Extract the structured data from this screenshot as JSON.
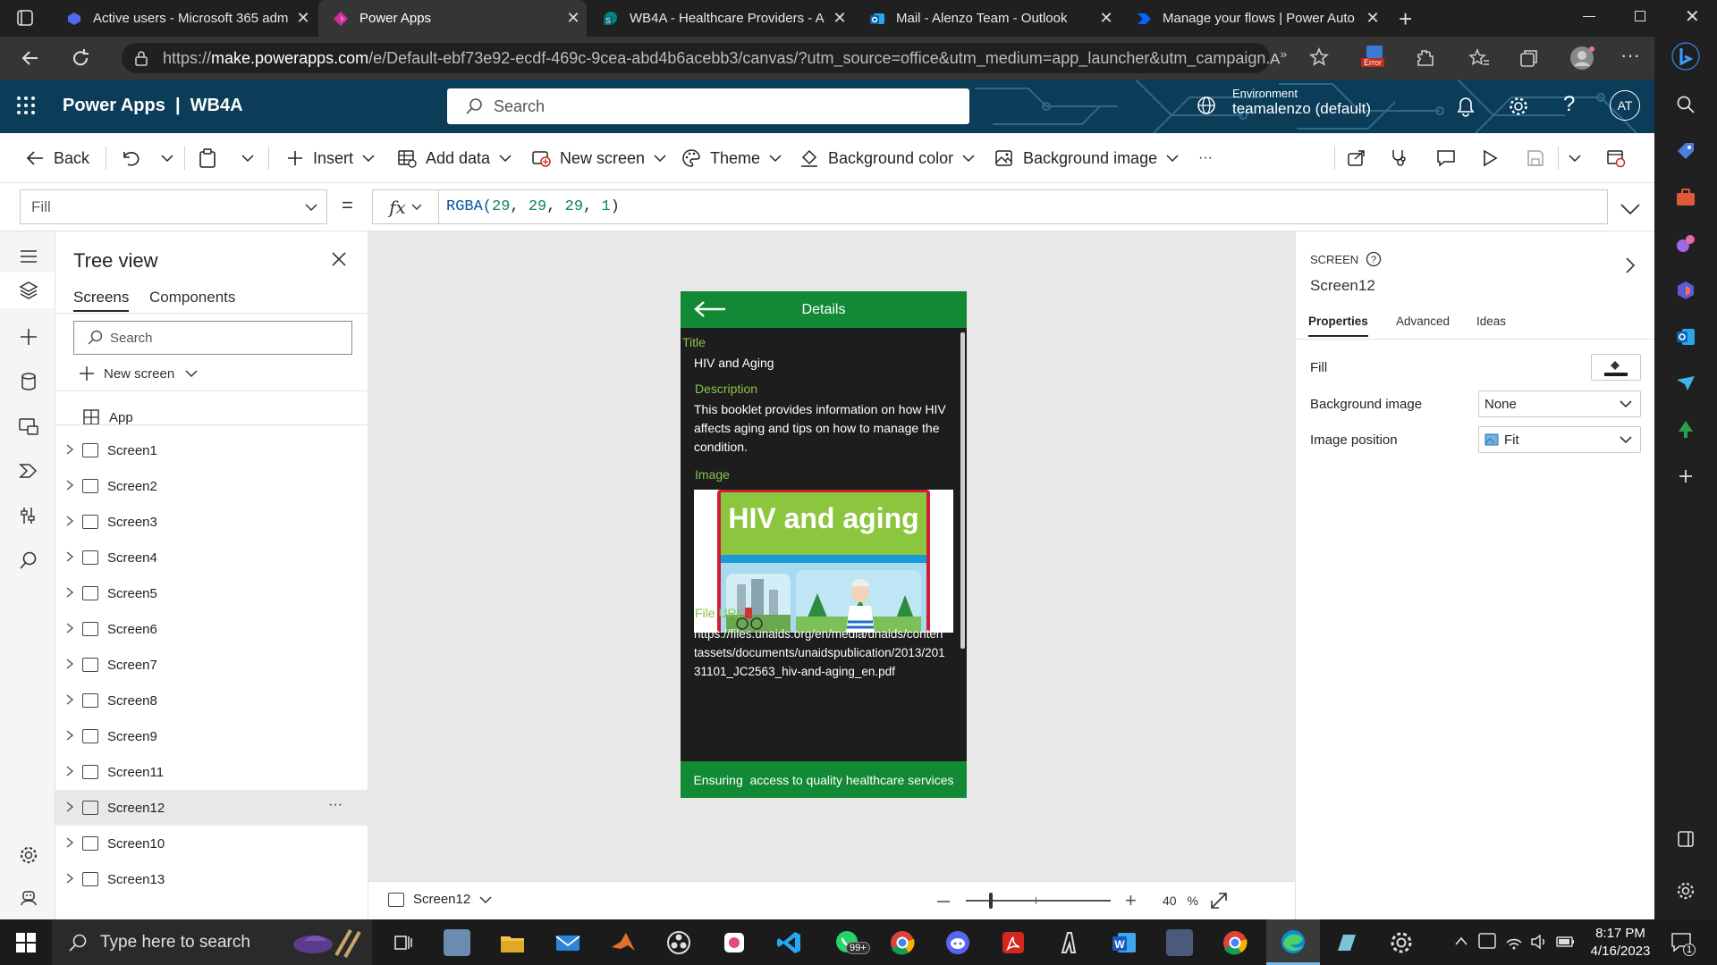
{
  "browser": {
    "tabs": [
      {
        "title": "Active users - Microsoft 365 adm",
        "icon": "m365-admin-icon",
        "active": false
      },
      {
        "title": "Power Apps",
        "icon": "power-apps-icon",
        "active": true
      },
      {
        "title": "WB4A - Healthcare Providers - A",
        "icon": "sharepoint-icon",
        "active": false
      },
      {
        "title": "Mail - Alenzo Team - Outlook",
        "icon": "outlook-icon",
        "active": false
      },
      {
        "title": "Manage your flows | Power Auto",
        "icon": "power-automate-icon",
        "active": false
      }
    ],
    "url_prefix": "https://",
    "url_host": "make.powerapps.com",
    "url_rest": "/e/Default-ebf73e92-ecdf-469c-9cea-abd4b6acebb3/canvas/?utm_source=office&utm_medium=app_launcher&utm_campaign...",
    "error_badge": "Error"
  },
  "header": {
    "brand": "Power Apps  |  WB4A",
    "search_placeholder": "Search",
    "environment_label": "Environment",
    "environment_value": "teamalenzo (default)",
    "avatar_initials": "AT"
  },
  "toolbar": {
    "back": "Back",
    "insert": "Insert",
    "add_data": "Add data",
    "new_screen": "New screen",
    "theme": "Theme",
    "background_color": "Background color",
    "background_image": "Background image",
    "more": "···"
  },
  "formula_bar": {
    "property": "Fill",
    "equals": "=",
    "fx": "fx",
    "formula_fn": "RGBA(",
    "formula_args": [
      "29",
      "29",
      "29",
      "1"
    ],
    "formula_end": ")"
  },
  "tree_view": {
    "title": "Tree view",
    "tabs": [
      "Screens",
      "Components"
    ],
    "search_placeholder": "Search",
    "new_screen": "New screen",
    "app_item": "App",
    "screens": [
      "Screen1",
      "Screen2",
      "Screen3",
      "Screen4",
      "Screen5",
      "Screen6",
      "Screen7",
      "Screen8",
      "Screen9",
      "Screen11",
      "Screen12",
      "Screen10",
      "Screen13"
    ],
    "selected": "Screen12",
    "more": "···"
  },
  "app_screen": {
    "header": "Details",
    "title_label": "Title",
    "title_value": "HIV and Aging",
    "description_label": "Description",
    "description_value": "This booklet provides information on how HIV affects aging and tips on how to manage the condition.",
    "image_label": "Image",
    "image_caption": "HIV and aging",
    "file_url_label": "File URL",
    "file_url_value": "https://files.unaids.org/en/media/unaids/contentassets/documents/unaidspublication/2013/20131101_JC2563_hiv-and-aging_en.pdf",
    "footer": "Ensuring  access to quality healthcare services",
    "fill_color": "#1d1d1d",
    "accent_color": "#128a35",
    "label_color": "#8bc34a"
  },
  "canvas_footer": {
    "screen": "Screen12",
    "zoom_value": "40",
    "zoom_unit": "%",
    "zoom_level": 0.4
  },
  "properties": {
    "kind": "SCREEN",
    "name": "Screen12",
    "tabs": [
      "Properties",
      "Advanced",
      "Ideas"
    ],
    "fill_label": "Fill",
    "bg_image_label": "Background image",
    "bg_image_value": "None",
    "img_position_label": "Image position",
    "img_position_value": "Fit"
  },
  "taskbar": {
    "search_placeholder": "Type here to search",
    "whatsapp_badge": "99+",
    "time": "8:17 PM",
    "date": "4/16/2023",
    "notification_count": "1"
  }
}
